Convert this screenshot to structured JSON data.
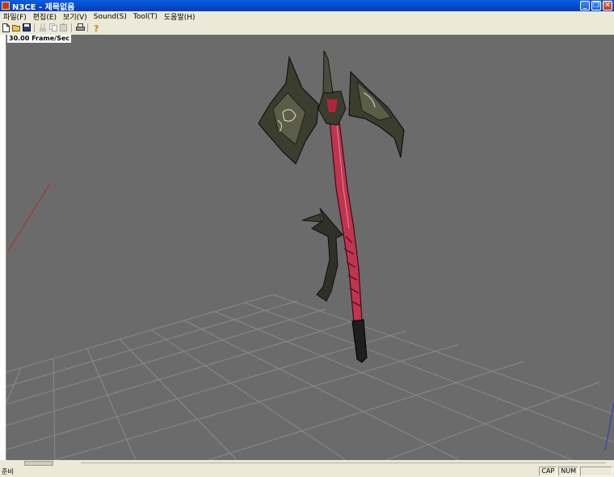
{
  "window": {
    "title": "N3CE - 제목없음",
    "buttons": {
      "minimize": "_",
      "restore": "❐",
      "close": "✕"
    }
  },
  "menu": [
    {
      "label": "파일(F)"
    },
    {
      "label": "편집(E)"
    },
    {
      "label": "보기(V)"
    },
    {
      "label": "Sound(S)"
    },
    {
      "label": "Tool(T)"
    },
    {
      "label": "도움말(H)"
    }
  ],
  "toolbar": {
    "icons": [
      "new-file-icon",
      "open-folder-icon",
      "save-icon",
      "cut-icon",
      "copy-icon",
      "paste-icon",
      "print-icon",
      "help-icon"
    ]
  },
  "viewport": {
    "fps_label": "30.00 Frame/Sec",
    "background": "#6b6b6b",
    "grid_color": "#8a8a8a"
  },
  "status": {
    "text": "준비",
    "caps": "CAP",
    "num": "NUM",
    "scrl": ""
  },
  "colors": {
    "title_blue": "#0548c9",
    "axe_red": "#c0354e",
    "axe_blade": "#3b3d2e"
  }
}
